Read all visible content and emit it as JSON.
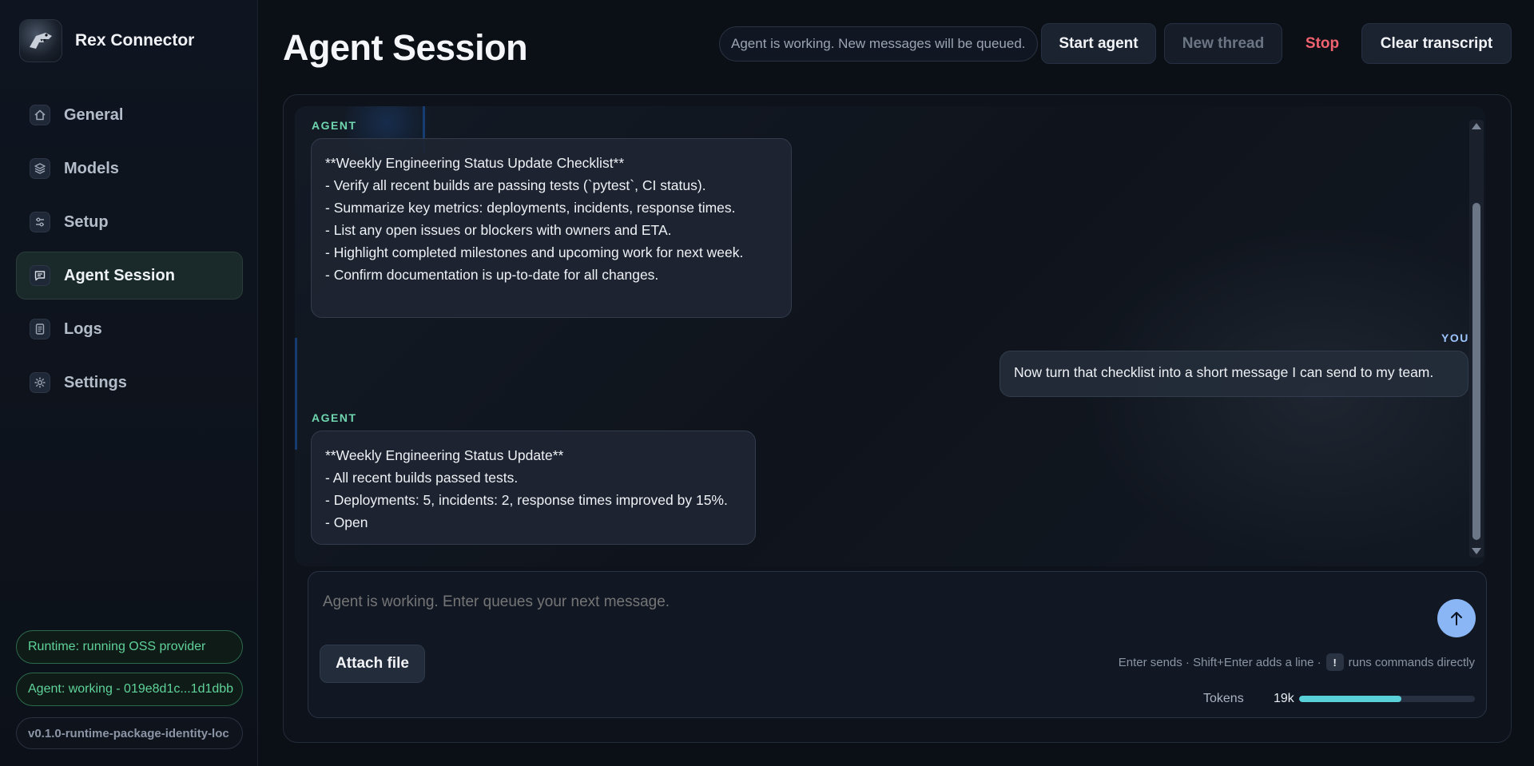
{
  "app": {
    "name": "Rex Connector",
    "logo_icon": "dinosaur-logo"
  },
  "sidebar": {
    "items": [
      {
        "label": "General",
        "icon": "home-icon"
      },
      {
        "label": "Models",
        "icon": "layers-icon"
      },
      {
        "label": "Setup",
        "icon": "sliders-icon"
      },
      {
        "label": "Agent Session",
        "icon": "chat-icon",
        "active": true
      },
      {
        "label": "Logs",
        "icon": "document-icon"
      },
      {
        "label": "Settings",
        "icon": "gear-icon"
      }
    ],
    "runtime_status": "Runtime: running OSS provider",
    "agent_status": "Agent: working - 019e8d1c...1d1dbb",
    "version": "v0.1.0-runtime-package-identity-loc"
  },
  "header": {
    "title": "Agent Session",
    "queue_note": "Agent is working. New messages will be queued.",
    "start_agent": "Start agent",
    "new_thread": "New thread",
    "stop": "Stop",
    "clear_transcript": "Clear transcript"
  },
  "messages": [
    {
      "role": "AGENT",
      "lines": [
        "**Weekly Engineering Status Update Checklist**",
        "",
        "- Verify all recent builds are passing tests (`pytest`, CI status).",
        "- Summarize key metrics: deployments, incidents, response times.",
        "- List any open issues or blockers with owners and ETA.",
        "- Highlight completed milestones and upcoming work for next week.",
        "- Confirm documentation is up-to-date for all changes."
      ]
    },
    {
      "role": "YOU",
      "lines": [
        "Now turn that checklist into a short message I can send to my team."
      ]
    },
    {
      "role": "AGENT",
      "lines": [
        "**Weekly Engineering Status Update**",
        "- All recent builds passed tests.",
        "- Deployments: 5, incidents: 2, response times improved by 15%.",
        "- Open"
      ]
    }
  ],
  "composer": {
    "placeholder": "Agent is working. Enter queues your next message.",
    "attach_label": "Attach file",
    "hint_before": "Enter sends · Shift+Enter adds a line ·",
    "hint_key": "!",
    "hint_after": "runs commands directly",
    "tokens_label": "Tokens",
    "tokens_value": "19k",
    "tokens_fill_fraction": 0.58
  },
  "colors": {
    "accent_green": "#5fd39a",
    "stop_red": "#f0626f",
    "send_blue": "#8ab6f5",
    "tokens_bar": "#5ad1d9"
  }
}
